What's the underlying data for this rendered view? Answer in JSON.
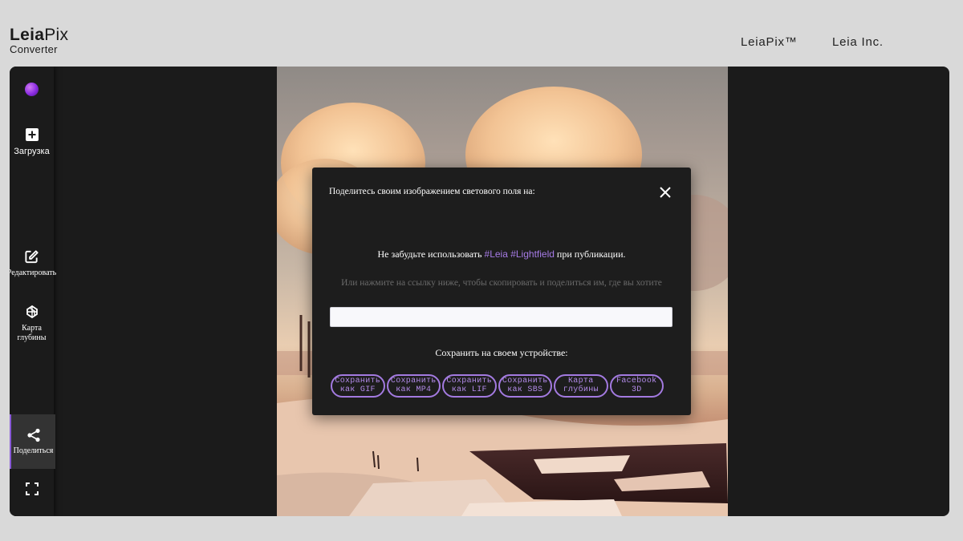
{
  "header": {
    "logo_main": "Leia",
    "logo_suffix": "Pix",
    "logo_sub": "Converter",
    "nav": [
      "LeiaPix™",
      "Leia Inc."
    ]
  },
  "sidebar": {
    "items": [
      {
        "label": "",
        "icon": "leia-orb-icon"
      },
      {
        "label": "Загрузка",
        "icon": "plus-box-icon"
      },
      {
        "label": "Редактировать",
        "icon": "edit-icon"
      },
      {
        "label": "Карта глубины",
        "icon": "depth-map-icon"
      },
      {
        "label": "Поделиться",
        "icon": "share-icon",
        "active": true
      },
      {
        "label": "",
        "icon": "fullscreen-icon"
      }
    ]
  },
  "modal": {
    "title": "Поделитесь своим изображением светового поля на:",
    "reminder_before": "Не забудьте использовать ",
    "reminder_tags": "#Leia #Lightfield",
    "reminder_after": " при публикации.",
    "hint": "Или нажмите на ссылку ниже, чтобы скопировать и поделиться им, где вы хотите",
    "link_value": "",
    "save_heading": "Сохранить на своем устройстве:",
    "buttons": [
      "Сохранить\nкак GIF",
      "Сохранить\nкак MP4",
      "Сохранить\nкак LIF",
      "Сохранить\nкак SBS",
      "Карта\nглубины",
      "Facebook\n3D"
    ]
  },
  "colors": {
    "accent": "#a37ae0",
    "panel": "#1b1b1b",
    "page_bg": "#d9d9d9"
  }
}
